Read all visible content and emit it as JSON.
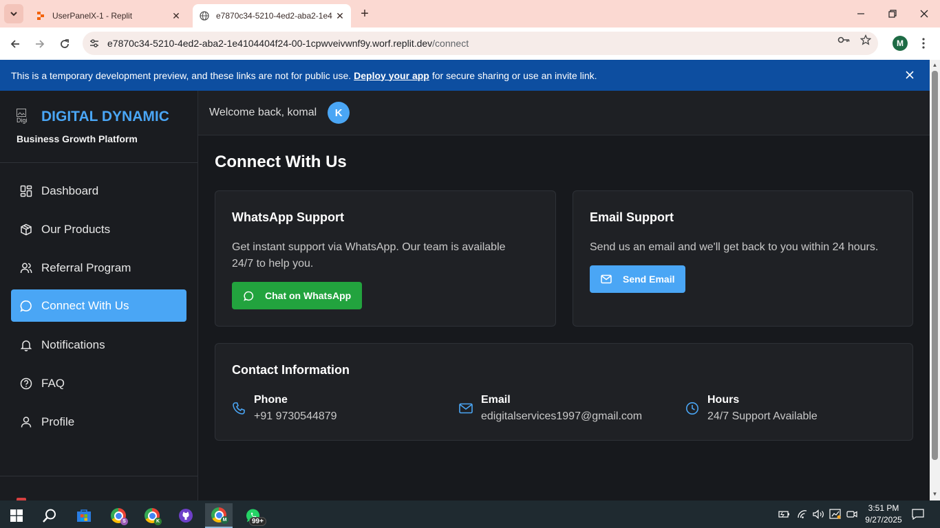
{
  "browser": {
    "tabs": [
      {
        "title": "UserPanelX-1 - Replit",
        "active": false
      },
      {
        "title": "e7870c34-5210-4ed2-aba2-1e4",
        "active": true
      }
    ],
    "url_host": "e7870c34-5210-4ed2-aba2-1e4104404f24-00-1cpwveivwnf9y.worf.replit.dev",
    "url_path": "/connect",
    "profile_initial": "M"
  },
  "banner": {
    "text_before": "This is a temporary development preview, and these links are not for public use.",
    "link": "Deploy your app",
    "text_after": "for secure sharing or use an invite link."
  },
  "sidebar": {
    "logo_alt": "Digi",
    "brand_name": "DIGITAL DYNAMIC",
    "tagline": "Business Growth Platform",
    "items": [
      {
        "label": "Dashboard",
        "icon": "dashboard-icon"
      },
      {
        "label": "Our Products",
        "icon": "box-icon"
      },
      {
        "label": "Referral Program",
        "icon": "users-icon"
      },
      {
        "label": "Connect With Us",
        "icon": "chat-icon",
        "active": true
      },
      {
        "label": "Notifications",
        "icon": "bell-icon"
      },
      {
        "label": "FAQ",
        "icon": "help-circle-icon"
      },
      {
        "label": "Profile",
        "icon": "user-icon"
      }
    ]
  },
  "header": {
    "welcome": "Welcome back, komal",
    "avatar_initial": "K"
  },
  "main": {
    "title": "Connect With Us",
    "whatsapp": {
      "title": "WhatsApp Support",
      "desc_line1": "Get instant support via WhatsApp. Our team is available",
      "desc_line2": "24/7 to help you.",
      "button": "Chat on WhatsApp"
    },
    "email": {
      "title": "Email Support",
      "desc": "Send us an email and we'll get back to you within 24 hours.",
      "button": "Send Email"
    },
    "contact": {
      "title": "Contact Information",
      "phone_label": "Phone",
      "phone_value": "+91 9730544879",
      "email_label": "Email",
      "email_value": "edigitalservices1997@gmail.com",
      "hours_label": "Hours",
      "hours_value": "24/7 Support Available"
    }
  },
  "taskbar": {
    "chrome_badge_1": "S",
    "chrome_badge_2": "K",
    "chrome_badge_3": "M",
    "whatsapp_badge": "99+",
    "time": "3:51 PM",
    "date": "9/27/2025"
  },
  "colors": {
    "accent": "#4aa6f5",
    "whatsapp_green": "#22a33e",
    "banner_blue": "#0d4ea0",
    "background": "#17191d",
    "card": "#1f2125"
  }
}
